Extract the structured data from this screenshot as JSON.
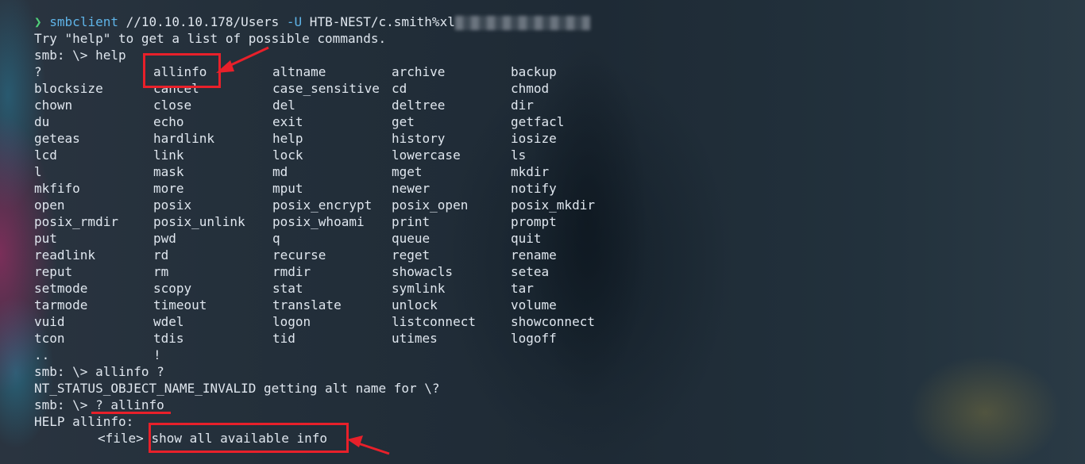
{
  "prompt": {
    "arrow": "❯",
    "command": "smbclient",
    "args": " //10.10.10.178/Users ",
    "flag": "-U",
    "user": " HTB-NEST/c.smith%xl"
  },
  "lines": {
    "try_help": "Try \"help\" to get a list of possible commands.",
    "smb_help": "smb: \\> help",
    "smb_allinfo_q": "smb: \\> allinfo ?",
    "nt_status": "NT_STATUS_OBJECT_NAME_INVALID getting alt name for \\?",
    "smb_q_allinfo": "smb: \\> ? allinfo",
    "help_allinfo": "HELP allinfo:",
    "usage_file": "<file>",
    "usage_desc": "show all available info"
  },
  "commands": [
    [
      "?",
      "allinfo",
      "altname",
      "archive",
      "backup"
    ],
    [
      "blocksize",
      "cancel",
      "case_sensitive",
      "cd",
      "chmod"
    ],
    [
      "chown",
      "close",
      "del",
      "deltree",
      "dir"
    ],
    [
      "du",
      "echo",
      "exit",
      "get",
      "getfacl"
    ],
    [
      "geteas",
      "hardlink",
      "help",
      "history",
      "iosize"
    ],
    [
      "lcd",
      "link",
      "lock",
      "lowercase",
      "ls"
    ],
    [
      "l",
      "mask",
      "md",
      "mget",
      "mkdir"
    ],
    [
      "mkfifo",
      "more",
      "mput",
      "newer",
      "notify"
    ],
    [
      "open",
      "posix",
      "posix_encrypt",
      "posix_open",
      "posix_mkdir"
    ],
    [
      "posix_rmdir",
      "posix_unlink",
      "posix_whoami",
      "print",
      "prompt"
    ],
    [
      "put",
      "pwd",
      "q",
      "queue",
      "quit"
    ],
    [
      "readlink",
      "rd",
      "recurse",
      "reget",
      "rename"
    ],
    [
      "reput",
      "rm",
      "rmdir",
      "showacls",
      "setea"
    ],
    [
      "setmode",
      "scopy",
      "stat",
      "symlink",
      "tar"
    ],
    [
      "tarmode",
      "timeout",
      "translate",
      "unlock",
      "volume"
    ],
    [
      "vuid",
      "wdel",
      "logon",
      "listconnect",
      "showconnect"
    ],
    [
      "tcon",
      "tdis",
      "tid",
      "utimes",
      "logoff"
    ],
    [
      "..",
      "!",
      "",
      "",
      ""
    ]
  ],
  "colors": {
    "text": "#dfe6ee",
    "prompt_arrow": "#4fd07a",
    "command": "#5fb4e8",
    "annotation": "#e8202a"
  }
}
